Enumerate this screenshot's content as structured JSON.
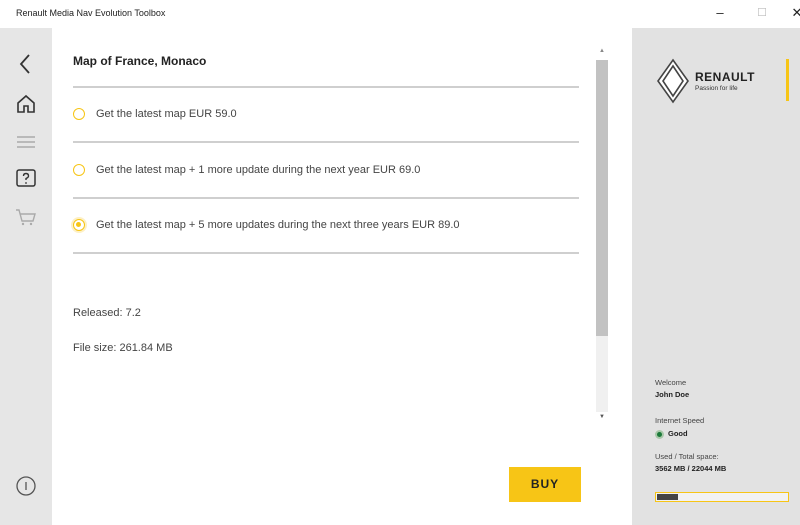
{
  "window": {
    "title": "Renault Media Nav Evolution Toolbox",
    "minimize_glyph": "–",
    "maximize_glyph": "☐",
    "close_glyph": "✕"
  },
  "nav": {
    "items": [
      {
        "icon": "back-arrow-icon"
      },
      {
        "icon": "home-icon"
      },
      {
        "icon": "menu-icon"
      },
      {
        "icon": "help-icon"
      },
      {
        "icon": "cart-icon"
      },
      {
        "icon": "info-icon"
      }
    ]
  },
  "content": {
    "map_title": "Map of France, Monaco",
    "options": [
      {
        "label": "Get the latest map EUR 59.0",
        "selected": false
      },
      {
        "label": "Get the latest map + 1 more update during the next year EUR 69.0",
        "selected": false
      },
      {
        "label": "Get the latest map + 5 more updates during the next three years EUR 89.0",
        "selected": true
      }
    ],
    "released": "Released: 7.2",
    "file_size": "File size: 261.84 MB",
    "buy_label": "BUY",
    "scroll_up_glyph": "▲",
    "scroll_down_glyph": "▼"
  },
  "sidebar": {
    "brand": "RENAULT",
    "slogan": "Passion for life",
    "welcome_label": "Welcome",
    "user_name": "John Doe",
    "internet_label": "Internet Speed",
    "internet_status": "Good",
    "space_label": "Used / Total space:",
    "space_value": "3562 MB / 22044 MB",
    "space_used_fraction": 0.16
  },
  "colors": {
    "accent": "#f7c516",
    "status_good": "#1c7a3a"
  }
}
